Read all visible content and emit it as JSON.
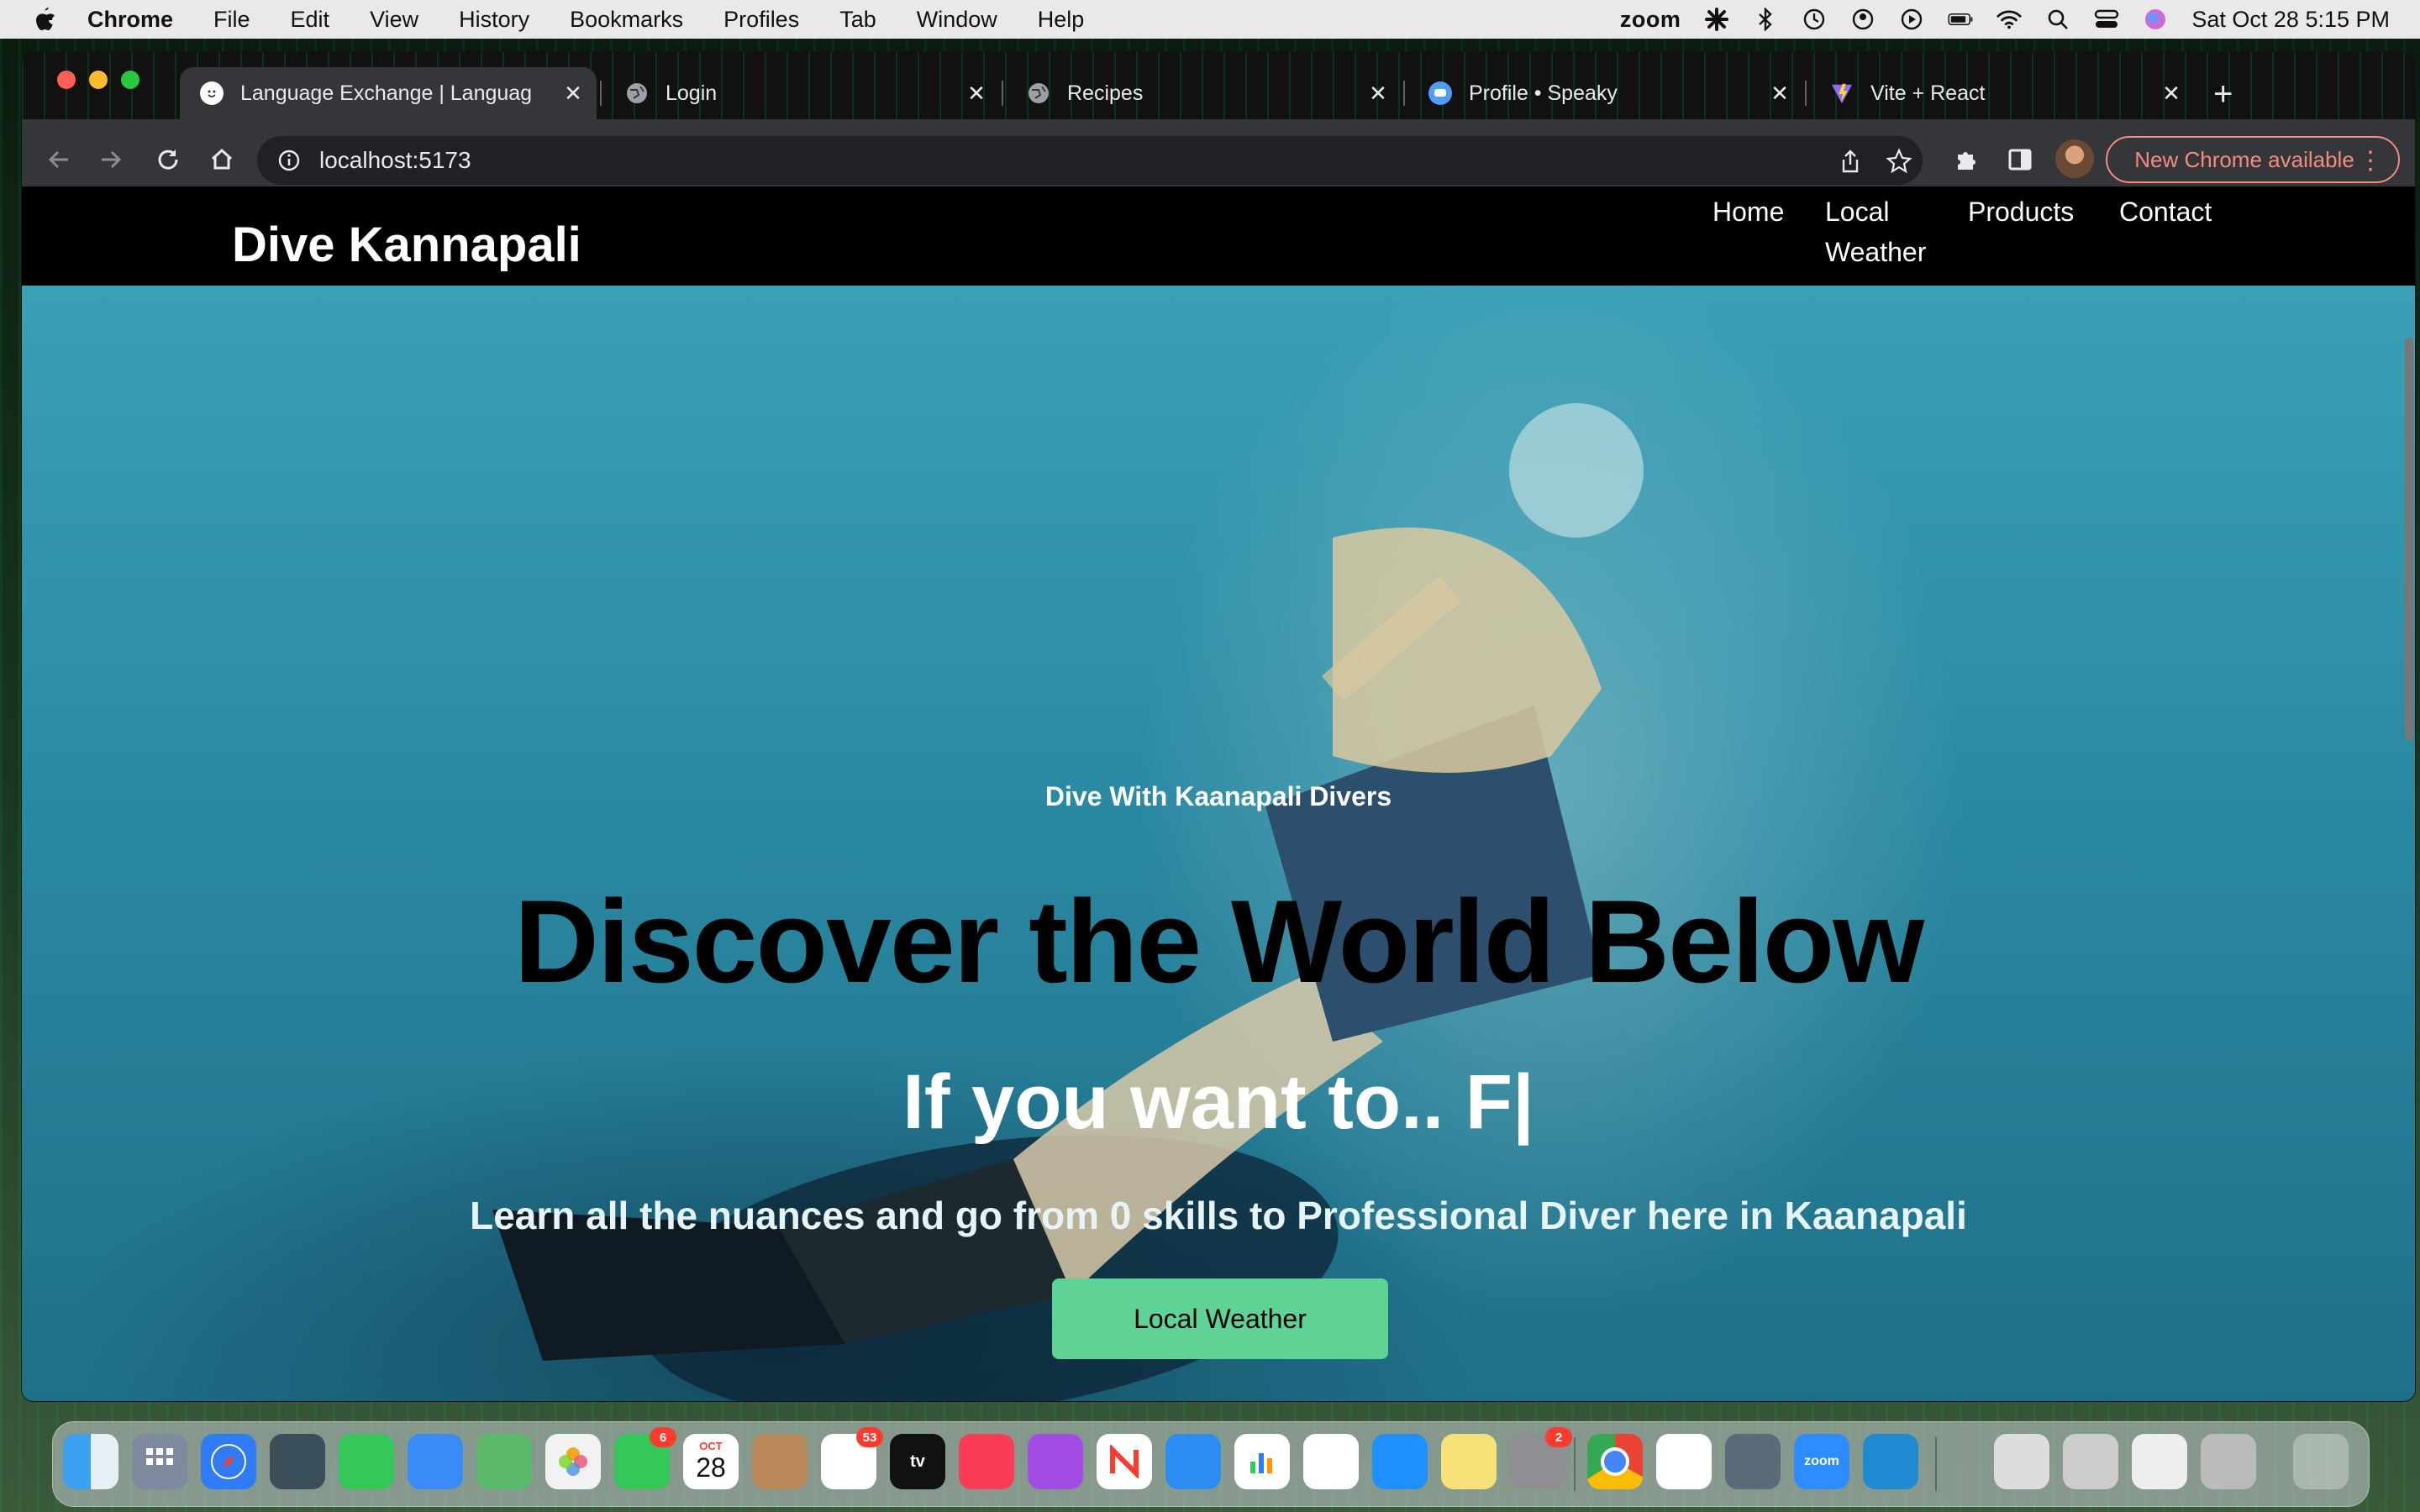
{
  "menubar": {
    "app": "Chrome",
    "menus": [
      "File",
      "Edit",
      "View",
      "History",
      "Bookmarks",
      "Profiles",
      "Tab",
      "Window",
      "Help"
    ],
    "zoom_label": "zoom",
    "datetime": "Sat Oct 28  5:15 PM"
  },
  "browser": {
    "tabs": [
      {
        "title": "Language Exchange | Languag",
        "icon": "smiley-icon"
      },
      {
        "title": "Login",
        "icon": "globe-icon"
      },
      {
        "title": "Recipes",
        "icon": "globe-icon"
      },
      {
        "title": "Profile • Speaky",
        "icon": "speaky-icon"
      },
      {
        "title": "Vite + React",
        "icon": "vite-icon"
      }
    ],
    "url": "localhost:5173",
    "update_label": "New Chrome available"
  },
  "site": {
    "brand": "Dive Kannapali",
    "nav": {
      "home": "Home",
      "weather_line1": "Local",
      "weather_line2": "Weather",
      "products": "Products",
      "contact": "Contact"
    },
    "hero": {
      "eyebrow": "Dive With Kaanapali Divers",
      "headline": "Discover the World Below",
      "typed": "If you want to..  F|",
      "subtitle": "Learn all the nuances and go from 0 skills to Professional Diver here in Kaanapali",
      "cta": "Local Weather"
    },
    "colors": {
      "nav_bg": "#000000",
      "cta": "#5fd396",
      "water": "#2d91a8"
    }
  },
  "dock": {
    "calendar": {
      "month": "OCT",
      "day": "28"
    },
    "badges": {
      "facetime": "6",
      "reminders": "53",
      "settings": "2"
    },
    "tv_label": "tv",
    "zoom_label": "zoom"
  }
}
